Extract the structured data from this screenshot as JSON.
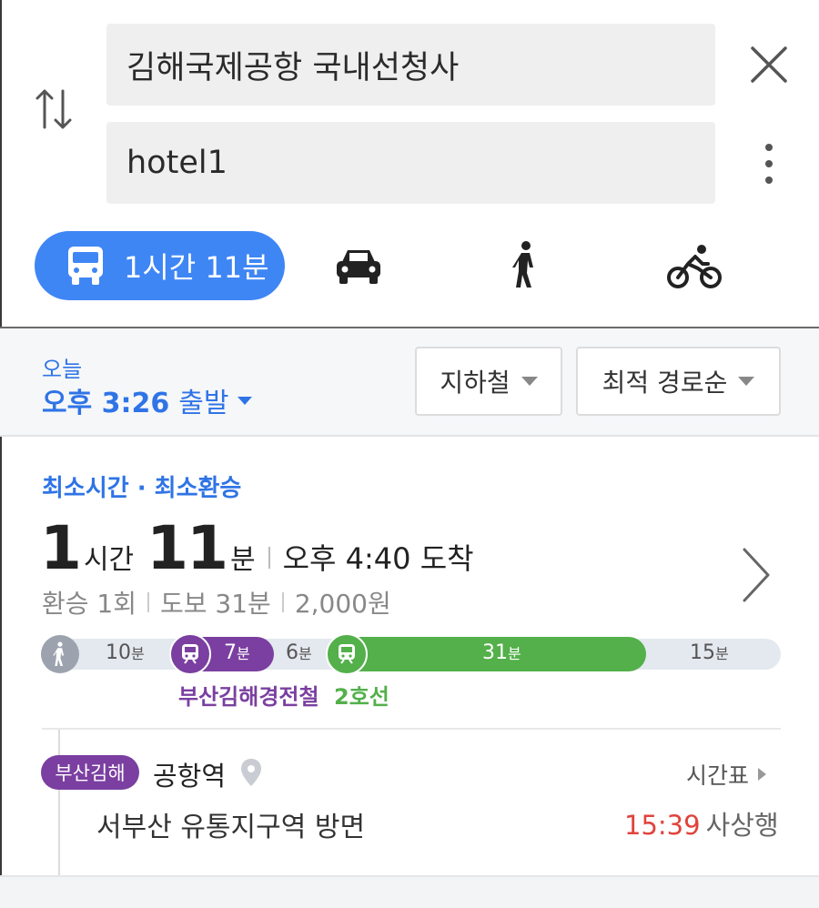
{
  "search": {
    "origin_value": "김해국제공항 국내선청사",
    "destination_value": "hotel1"
  },
  "modes": {
    "transit_label": "1시간 11분",
    "icons": [
      "bus-icon",
      "car-icon",
      "walk-icon",
      "bike-icon"
    ]
  },
  "options": {
    "day": "오늘",
    "depart_time": "오후 3:26",
    "depart_word": "출발",
    "filter_label": "지하철",
    "sort_label": "최적 경로순"
  },
  "route": {
    "tags": "최소시간 · 최소환승",
    "hours": "1",
    "hours_unit": "시간",
    "minutes": "11",
    "minutes_unit": "분",
    "arrival": "오후 4:40 도착",
    "transfers": "환승 1회",
    "walk": "도보 31분",
    "fare": "2,000원",
    "timeline": {
      "walk1_value": "10",
      "purple_value": "7",
      "walk2_value": "6",
      "green_value": "31",
      "walk3_value": "15",
      "unit": "분"
    },
    "line1_name": "부산김해경전철",
    "line2_name": "2호선",
    "line1_color": "#7a3fa0",
    "line2_color": "#53b04a"
  },
  "station": {
    "badge": "부산김해",
    "name": "공항역",
    "timetable_label": "시간표",
    "direction": "서부산 유통지구역 방면",
    "next_time": "15:39",
    "next_dest": "사상행"
  },
  "colors": {
    "accent": "#3f86f5",
    "link": "#2f74e6",
    "alert": "#e0433b"
  }
}
